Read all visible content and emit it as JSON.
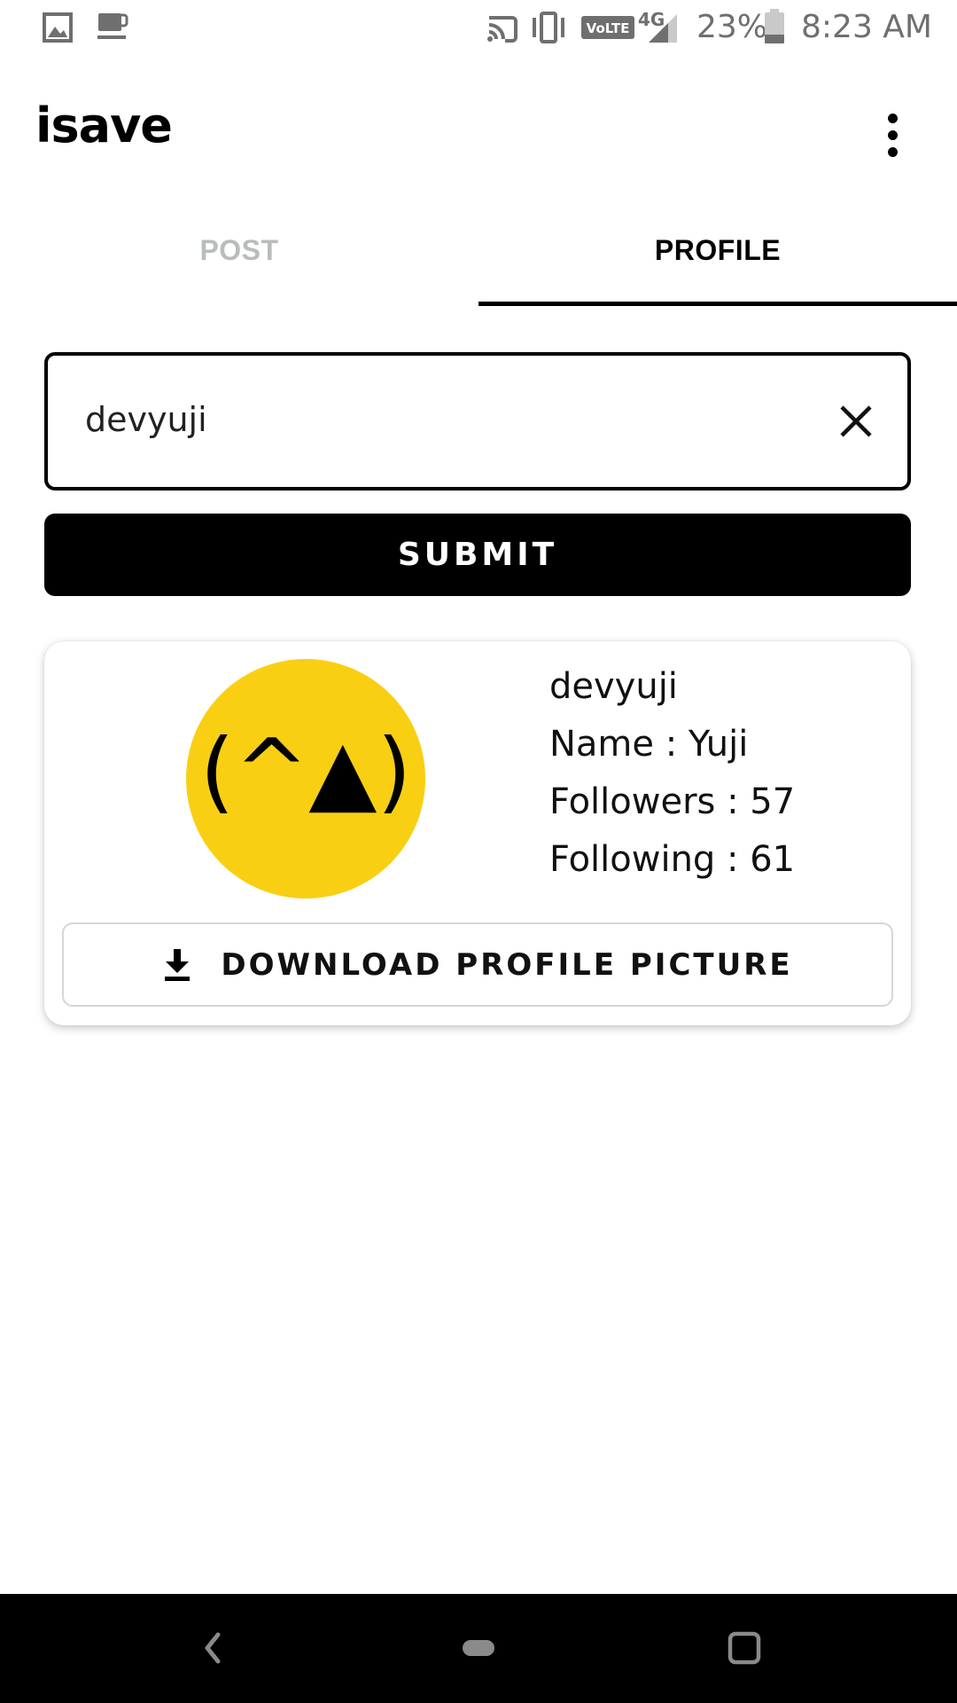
{
  "status_bar": {
    "battery": "23%",
    "time": "8:23 AM",
    "network_label": "4G",
    "volte_label": "VoLTE",
    "icons": [
      "image-icon",
      "coffee-icon",
      "cast-icon",
      "vibrate-icon",
      "volte-icon",
      "signal-icon",
      "battery-icon"
    ]
  },
  "app_bar": {
    "title": "isave",
    "menu_icon": "more-vert-icon"
  },
  "tabs": [
    {
      "label": "POST",
      "selected": false
    },
    {
      "label": "PROFILE",
      "selected": true
    }
  ],
  "search": {
    "value": "devyuji",
    "clear_icon": "close-icon"
  },
  "submit": {
    "label": "SUBMIT"
  },
  "profile": {
    "avatar_text": "(^▲)",
    "avatar_color": "#f9cf13",
    "username": "devyuji",
    "name": "Name : Yuji",
    "followers": "Followers : 57",
    "following": "Following : 61"
  },
  "download": {
    "label": "DOWNLOAD PROFILE PICTURE",
    "icon": "download-icon"
  },
  "nav_bar": {
    "icons": [
      "back-icon",
      "home-icon",
      "recents-icon"
    ]
  },
  "colors": {
    "accent": "#000000",
    "inactive_tab": "#b8bcbc",
    "avatar_bg": "#f9cf13"
  }
}
